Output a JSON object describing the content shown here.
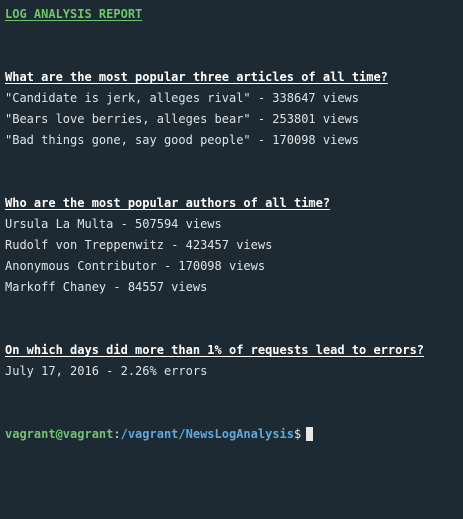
{
  "report": {
    "title": "LOG ANALYSIS REPORT",
    "sections": [
      {
        "heading": "What are the most popular three articles of all time?",
        "rows": [
          "\"Candidate is jerk, alleges rival\" - 338647 views",
          "\"Bears love berries, alleges bear\" - 253801 views",
          "\"Bad things gone, say good people\" - 170098 views"
        ]
      },
      {
        "heading": "Who are the most popular authors of all time?",
        "rows": [
          "Ursula La Multa - 507594 views",
          "Rudolf von Treppenwitz - 423457 views",
          "Anonymous Contributor - 170098 views",
          "Markoff Chaney - 84557 views"
        ]
      },
      {
        "heading": "On which days did more than 1% of requests lead to errors?",
        "rows": [
          "July 17, 2016 - 2.26% errors"
        ]
      }
    ]
  },
  "prompt": {
    "user_host": "vagrant@vagrant",
    "separator": ":",
    "path": "/vagrant/NewsLogAnalysis",
    "symbol": "$"
  }
}
